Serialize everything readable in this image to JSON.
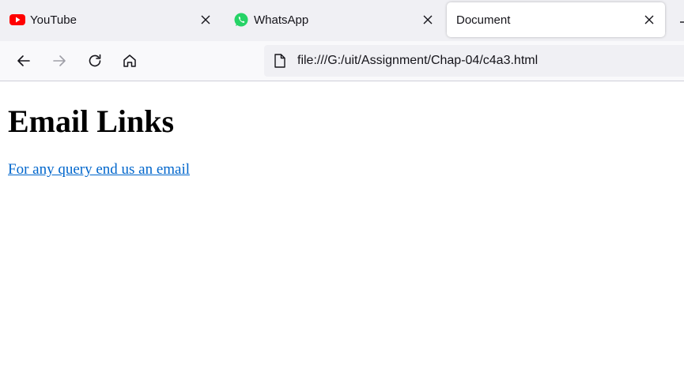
{
  "tabs": [
    {
      "title": "YouTube",
      "icon": "youtube-icon",
      "icon_color": "#ff0000",
      "active": false
    },
    {
      "title": "WhatsApp",
      "icon": "whatsapp-icon",
      "icon_color": "#25d366",
      "active": false
    },
    {
      "title": "Document",
      "icon": "",
      "active": true
    }
  ],
  "toolbar": {
    "back_icon": "back-arrow-icon",
    "forward_icon": "forward-arrow-icon",
    "reload_icon": "reload-icon",
    "home_icon": "home-icon"
  },
  "urlbar": {
    "url": "file:///G:/uit/Assignment/Chap-04/c4a3.html",
    "icon": "document-icon"
  },
  "page": {
    "heading": "Email Links",
    "link_text": "For any query end us an email",
    "link_color": "#0066cc"
  }
}
